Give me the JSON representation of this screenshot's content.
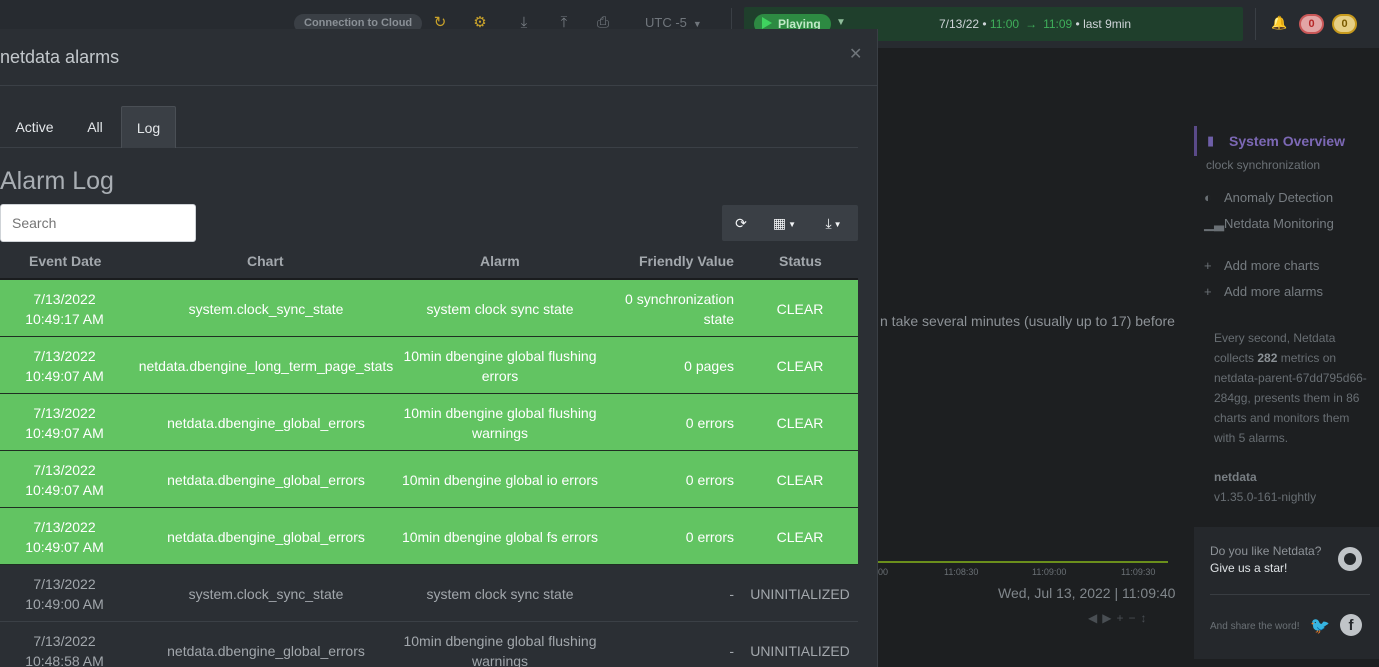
{
  "topbar": {
    "connection_label": "Connection to Cloud",
    "timezone": "UTC -5",
    "play_label": "Playing",
    "range_date": "7/13/22 •",
    "range_start": "11:00",
    "range_end": "11:09",
    "range_duration": "• last 9min",
    "alarms_critical": "0",
    "alarms_warning": "0"
  },
  "background": {
    "partial_text": "n take several minutes (usually up to 17) before",
    "chart_ticks": [
      "00",
      "11:08:30",
      "11:09:00",
      "11:09:30"
    ],
    "chart_date": "Wed, Jul 13, 2022 | 11:09:40"
  },
  "sidebar": {
    "active_item": "System Overview",
    "active_sub": "clock synchronization",
    "items": [
      {
        "label": "Anomaly Detection"
      },
      {
        "label": "Netdata Monitoring"
      },
      {
        "label": "Add more charts"
      },
      {
        "label": "Add more alarms"
      }
    ],
    "info": {
      "prefix": "Every second, Netdata collects",
      "metrics": "282",
      "middle": "metrics on netdata-parent-67dd795d66-284gg, presents them in 86 charts and monitors them with 5 alarms."
    },
    "version_name": "netdata",
    "version": "v1.35.0-161-nightly",
    "star_question": "Do you like Netdata?",
    "star_cta": "Give us a star!",
    "share_label": "And share the word!"
  },
  "modal": {
    "title": "netdata alarms",
    "tabs": [
      {
        "label": "Active"
      },
      {
        "label": "All"
      },
      {
        "label": "Log"
      }
    ],
    "log_title": "Alarm Log",
    "search_placeholder": "Search",
    "columns": [
      "Event Date",
      "Chart",
      "Alarm",
      "Friendly Value",
      "Status"
    ],
    "rows": [
      {
        "date": "7/13/2022",
        "time": "10:49:17 AM",
        "chart": "system.clock_sync_state",
        "alarm": "system clock sync state",
        "value": "0 synchronization state",
        "status": "CLEAR",
        "style": "green"
      },
      {
        "date": "7/13/2022",
        "time": "10:49:07 AM",
        "chart": "netdata.dbengine_long_term_page_stats",
        "alarm": "10min dbengine global flushing errors",
        "value": "0 pages",
        "status": "CLEAR",
        "style": "green"
      },
      {
        "date": "7/13/2022",
        "time": "10:49:07 AM",
        "chart": "netdata.dbengine_global_errors",
        "alarm": "10min dbengine global flushing warnings",
        "value": "0 errors",
        "status": "CLEAR",
        "style": "green"
      },
      {
        "date": "7/13/2022",
        "time": "10:49:07 AM",
        "chart": "netdata.dbengine_global_errors",
        "alarm": "10min dbengine global io errors",
        "value": "0 errors",
        "status": "CLEAR",
        "style": "green"
      },
      {
        "date": "7/13/2022",
        "time": "10:49:07 AM",
        "chart": "netdata.dbengine_global_errors",
        "alarm": "10min dbengine global fs errors",
        "value": "0 errors",
        "status": "CLEAR",
        "style": "green"
      },
      {
        "date": "7/13/2022",
        "time": "10:49:00 AM",
        "chart": "system.clock_sync_state",
        "alarm": "system clock sync state",
        "value": "-",
        "status": "UNINITIALIZED",
        "style": "gray"
      },
      {
        "date": "7/13/2022",
        "time": "10:48:58 AM",
        "chart": "netdata.dbengine_global_errors",
        "alarm": "10min dbengine global flushing warnings",
        "value": "-",
        "status": "UNINITIALIZED",
        "style": "gray"
      }
    ]
  }
}
